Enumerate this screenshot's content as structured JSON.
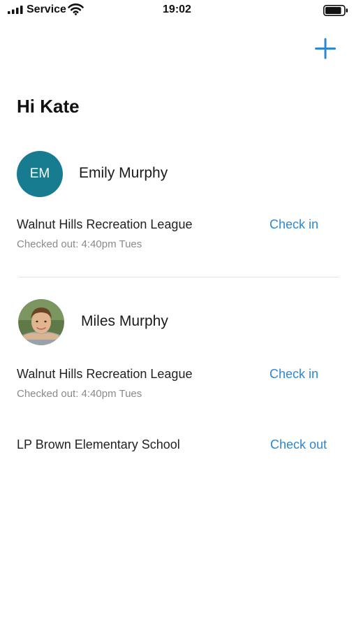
{
  "status_bar": {
    "carrier": "Service",
    "time": "19:02"
  },
  "header": {
    "greeting": "Hi Kate",
    "add_icon": "plus-icon"
  },
  "children": [
    {
      "name": "Emily Murphy",
      "initials": "EM",
      "avatar_color": "#187c91",
      "activities": [
        {
          "org": "Walnut Hills Recreation League",
          "status": "Checked out: 4:40pm Tues",
          "action": "Check in"
        }
      ]
    },
    {
      "name": "Miles Murphy",
      "avatar": "child-photo",
      "activities": [
        {
          "org": "Walnut Hills Recreation League",
          "status": "Checked out: 4:40pm Tues",
          "action": "Check in"
        },
        {
          "org": "LP Brown Elementary School",
          "action": "Check out"
        }
      ]
    }
  ],
  "colors": {
    "accent": "#2d87d3",
    "avatar_bg": "#187c91",
    "secondary_text": "#8a8a8a"
  }
}
